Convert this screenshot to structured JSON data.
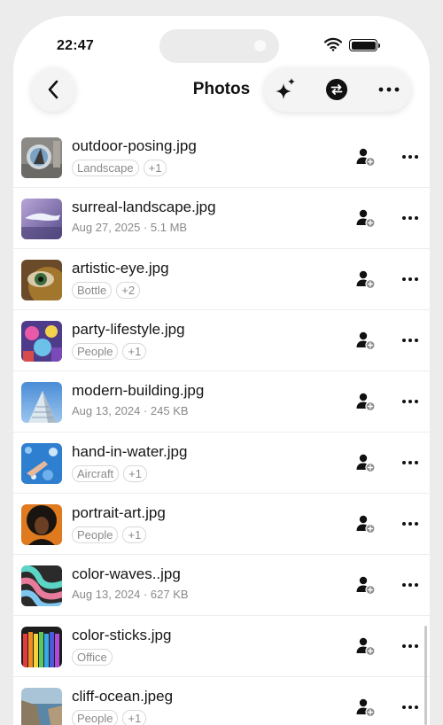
{
  "status_bar": {
    "time": "22:47"
  },
  "header": {
    "title": "Photos",
    "icons": [
      "back-chevron-icon",
      "sparkles-icon",
      "sync-icon",
      "more-icon"
    ]
  },
  "files": [
    {
      "name": "outdoor-posing.jpg",
      "tags": [
        "Landscape",
        "+1"
      ],
      "thumb": "outdoor"
    },
    {
      "name": "surreal-landscape.jpg",
      "info": "Aug 27, 2025 · 5.1 MB",
      "thumb": "surreal"
    },
    {
      "name": "artistic-eye.jpg",
      "tags": [
        "Bottle",
        "+2"
      ],
      "thumb": "eye"
    },
    {
      "name": "party-lifestyle.jpg",
      "tags": [
        "People",
        "+1"
      ],
      "thumb": "party"
    },
    {
      "name": "modern-building.jpg",
      "info": "Aug 13, 2024 · 245 KB",
      "thumb": "building"
    },
    {
      "name": "hand-in-water.jpg",
      "tags": [
        "Aircraft",
        "+1"
      ],
      "thumb": "water"
    },
    {
      "name": "portrait-art.jpg",
      "tags": [
        "People",
        "+1"
      ],
      "thumb": "portrait"
    },
    {
      "name": "color-waves..jpg",
      "info": "Aug 13, 2024 · 627 KB",
      "thumb": "waves"
    },
    {
      "name": "color-sticks.jpg",
      "tags": [
        "Office"
      ],
      "thumb": "sticks"
    },
    {
      "name": "cliff-ocean.jpeg",
      "tags": [
        "People",
        "+1"
      ],
      "thumb": "cliff"
    }
  ],
  "row_icons": [
    "share-person-icon",
    "more-icon"
  ]
}
